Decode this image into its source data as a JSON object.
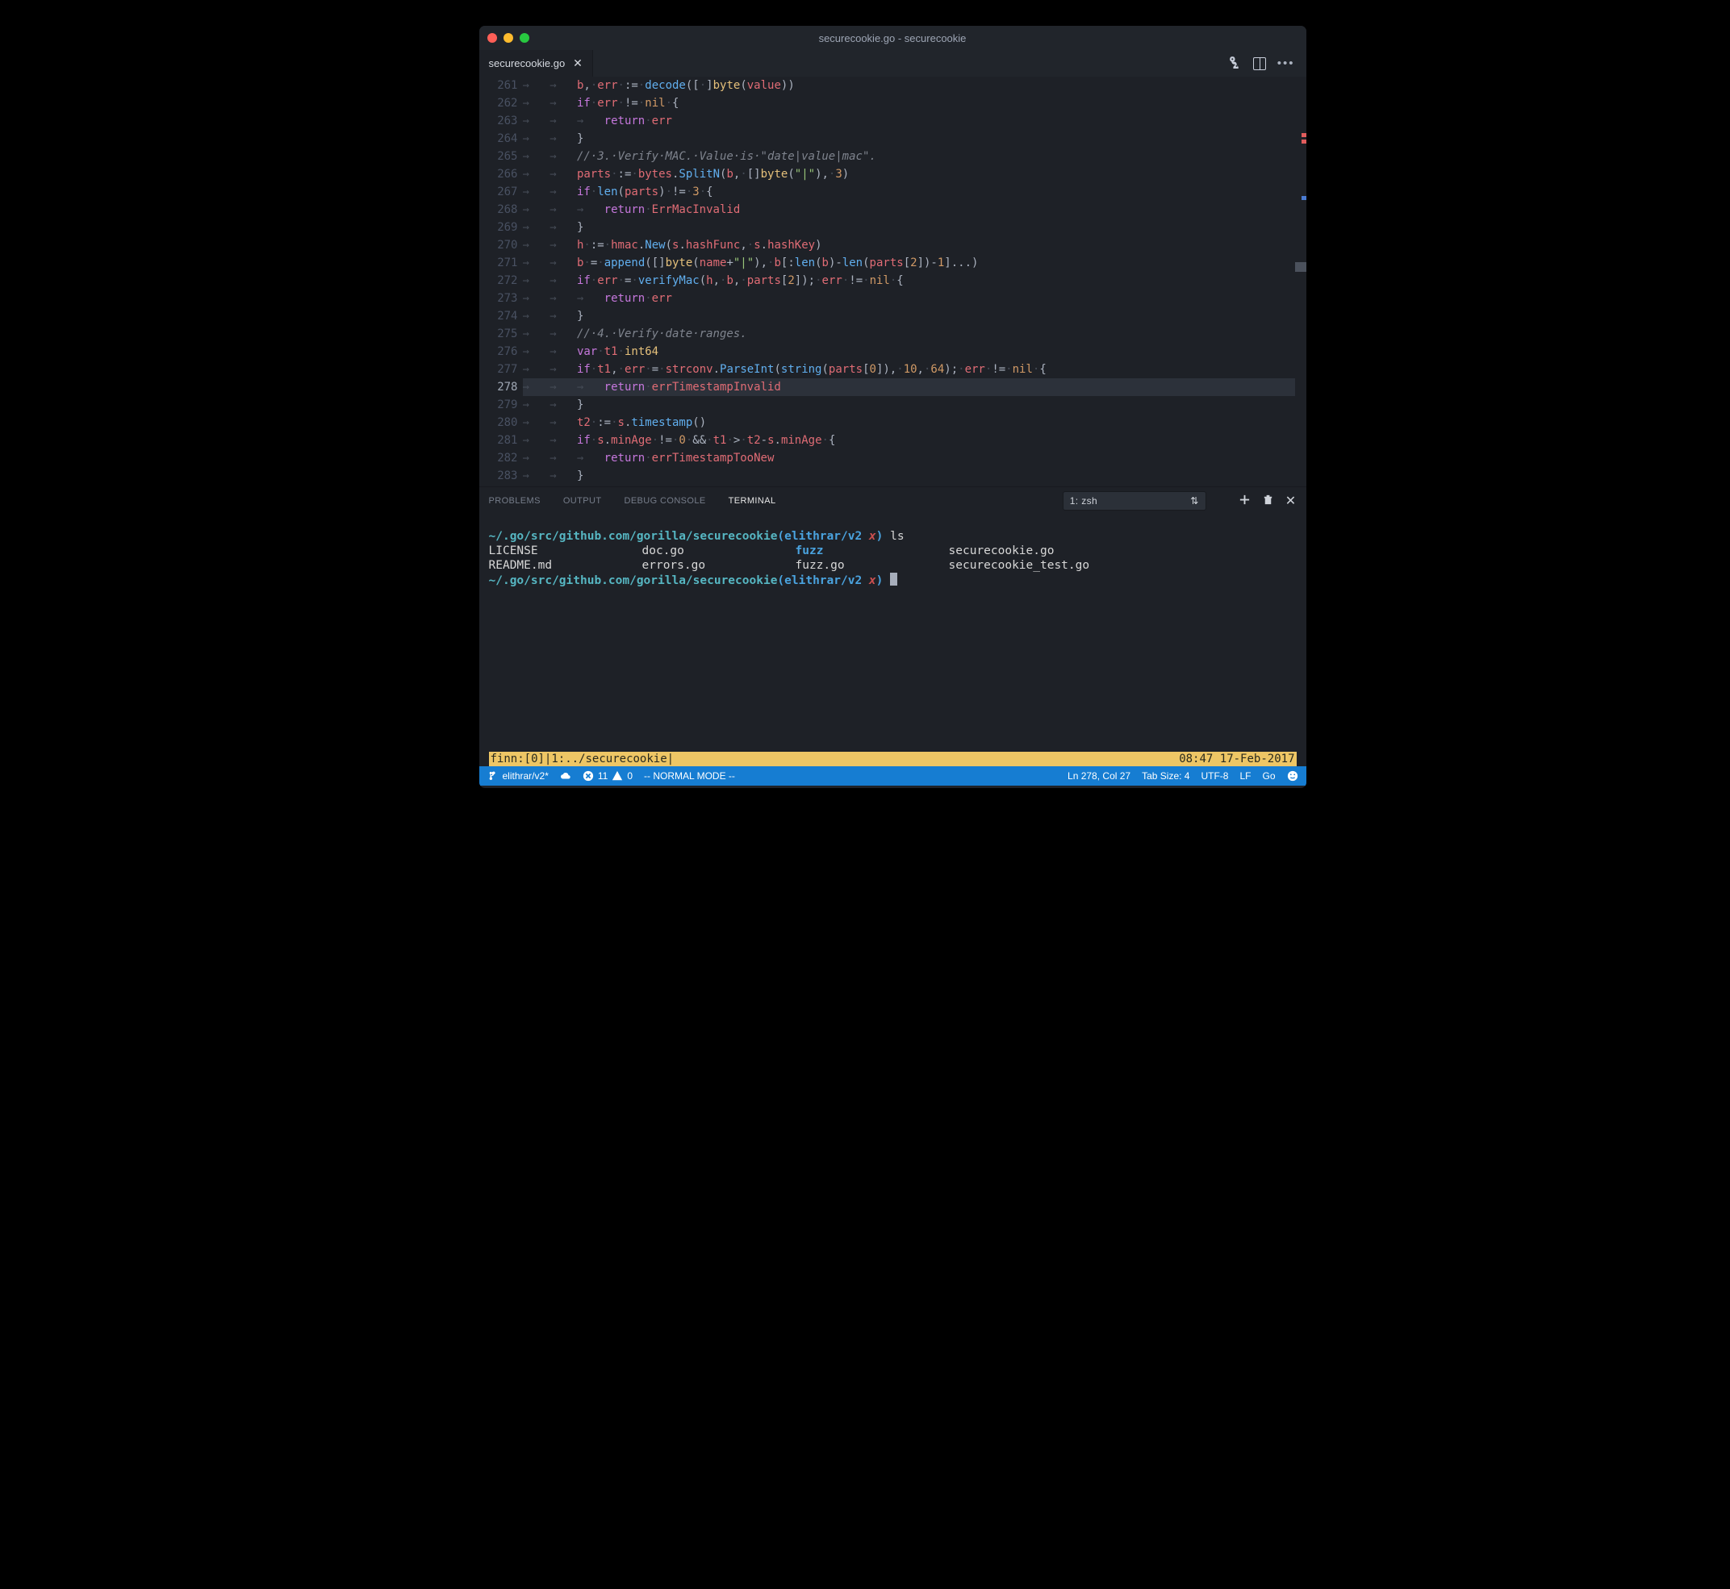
{
  "window": {
    "title": "securecookie.go - securecookie"
  },
  "tabs": [
    {
      "label": "securecookie.go",
      "closable": true,
      "active": true
    }
  ],
  "editor": {
    "highlighted_line": 278,
    "lines": [
      {
        "n": 261,
        "tokens": [
          [
            "ws",
            "→   "
          ],
          [
            "id",
            "b"
          ],
          [
            "p",
            ","
          ],
          [
            "ws",
            "·"
          ],
          [
            "id",
            "err"
          ],
          [
            "ws",
            "·"
          ],
          [
            "p",
            ":="
          ],
          [
            "ws",
            "·"
          ],
          [
            "fn",
            "decode"
          ],
          [
            "p",
            "(["
          ],
          [
            "ws",
            "·"
          ],
          [
            "p",
            "]"
          ],
          [
            "ty",
            "byte"
          ],
          [
            "p",
            "("
          ],
          [
            "id",
            "value"
          ],
          [
            "p",
            "))"
          ]
        ]
      },
      {
        "n": 262,
        "tokens": [
          [
            "ws",
            "→   "
          ],
          [
            "kw",
            "if"
          ],
          [
            "ws",
            "·"
          ],
          [
            "id",
            "err"
          ],
          [
            "ws",
            "·"
          ],
          [
            "p",
            "!="
          ],
          [
            "ws",
            "·"
          ],
          [
            "n",
            "nil"
          ],
          [
            "ws",
            "·"
          ],
          [
            "p",
            "{"
          ]
        ]
      },
      {
        "n": 263,
        "tokens": [
          [
            "ws",
            "→   →   "
          ],
          [
            "kw",
            "return"
          ],
          [
            "ws",
            "·"
          ],
          [
            "id",
            "err"
          ]
        ]
      },
      {
        "n": 264,
        "tokens": [
          [
            "ws",
            "→   "
          ],
          [
            "p",
            "}"
          ]
        ]
      },
      {
        "n": 265,
        "tokens": [
          [
            "ws",
            "→   "
          ],
          [
            "c",
            "//·3.·Verify·MAC.·Value·is·\"date|value|mac\"."
          ]
        ]
      },
      {
        "n": 266,
        "tokens": [
          [
            "ws",
            "→   "
          ],
          [
            "id",
            "parts"
          ],
          [
            "ws",
            "·"
          ],
          [
            "p",
            ":="
          ],
          [
            "ws",
            "·"
          ],
          [
            "id",
            "bytes"
          ],
          [
            "p",
            "."
          ],
          [
            "fn",
            "SplitN"
          ],
          [
            "p",
            "("
          ],
          [
            "id",
            "b"
          ],
          [
            "p",
            ","
          ],
          [
            "ws",
            "·"
          ],
          [
            "p",
            "[]"
          ],
          [
            "ty",
            "byte"
          ],
          [
            "p",
            "("
          ],
          [
            "s",
            "\"|\""
          ],
          [
            "p",
            "),"
          ],
          [
            "ws",
            "·"
          ],
          [
            "n",
            "3"
          ],
          [
            "p",
            ")"
          ]
        ]
      },
      {
        "n": 267,
        "tokens": [
          [
            "ws",
            "→   "
          ],
          [
            "kw",
            "if"
          ],
          [
            "ws",
            "·"
          ],
          [
            "fn",
            "len"
          ],
          [
            "p",
            "("
          ],
          [
            "id",
            "parts"
          ],
          [
            "p",
            ")"
          ],
          [
            "ws",
            "·"
          ],
          [
            "p",
            "!="
          ],
          [
            "ws",
            "·"
          ],
          [
            "n",
            "3"
          ],
          [
            "ws",
            "·"
          ],
          [
            "p",
            "{"
          ]
        ]
      },
      {
        "n": 268,
        "tokens": [
          [
            "ws",
            "→   →   "
          ],
          [
            "kw",
            "return"
          ],
          [
            "ws",
            "·"
          ],
          [
            "id",
            "ErrMacInvalid"
          ]
        ]
      },
      {
        "n": 269,
        "tokens": [
          [
            "ws",
            "→   "
          ],
          [
            "p",
            "}"
          ]
        ]
      },
      {
        "n": 270,
        "tokens": [
          [
            "ws",
            "→   "
          ],
          [
            "id",
            "h"
          ],
          [
            "ws",
            "·"
          ],
          [
            "p",
            ":="
          ],
          [
            "ws",
            "·"
          ],
          [
            "id",
            "hmac"
          ],
          [
            "p",
            "."
          ],
          [
            "fn",
            "New"
          ],
          [
            "p",
            "("
          ],
          [
            "id",
            "s"
          ],
          [
            "p",
            "."
          ],
          [
            "id",
            "hashFunc"
          ],
          [
            "p",
            ","
          ],
          [
            "ws",
            "·"
          ],
          [
            "id",
            "s"
          ],
          [
            "p",
            "."
          ],
          [
            "id",
            "hashKey"
          ],
          [
            "p",
            ")"
          ]
        ]
      },
      {
        "n": 271,
        "tokens": [
          [
            "ws",
            "→   "
          ],
          [
            "id",
            "b"
          ],
          [
            "ws",
            "·"
          ],
          [
            "p",
            "="
          ],
          [
            "ws",
            "·"
          ],
          [
            "fn",
            "append"
          ],
          [
            "p",
            "([]"
          ],
          [
            "ty",
            "byte"
          ],
          [
            "p",
            "("
          ],
          [
            "id",
            "name"
          ],
          [
            "p",
            "+"
          ],
          [
            "s",
            "\"|\""
          ],
          [
            "p",
            "),"
          ],
          [
            "ws",
            "·"
          ],
          [
            "id",
            "b"
          ],
          [
            "p",
            "[:"
          ],
          [
            "fn",
            "len"
          ],
          [
            "p",
            "("
          ],
          [
            "id",
            "b"
          ],
          [
            "p",
            ")-"
          ],
          [
            "fn",
            "len"
          ],
          [
            "p",
            "("
          ],
          [
            "id",
            "parts"
          ],
          [
            "p",
            "["
          ],
          [
            "n",
            "2"
          ],
          [
            "p",
            "])-"
          ],
          [
            "n",
            "1"
          ],
          [
            "p",
            "]...)"
          ]
        ]
      },
      {
        "n": 272,
        "tokens": [
          [
            "ws",
            "→   "
          ],
          [
            "kw",
            "if"
          ],
          [
            "ws",
            "·"
          ],
          [
            "id",
            "err"
          ],
          [
            "ws",
            "·"
          ],
          [
            "p",
            "="
          ],
          [
            "ws",
            "·"
          ],
          [
            "fn",
            "verifyMac"
          ],
          [
            "p",
            "("
          ],
          [
            "id",
            "h"
          ],
          [
            "p",
            ","
          ],
          [
            "ws",
            "·"
          ],
          [
            "id",
            "b"
          ],
          [
            "p",
            ","
          ],
          [
            "ws",
            "·"
          ],
          [
            "id",
            "parts"
          ],
          [
            "p",
            "["
          ],
          [
            "n",
            "2"
          ],
          [
            "p",
            "]);"
          ],
          [
            "ws",
            "·"
          ],
          [
            "id",
            "err"
          ],
          [
            "ws",
            "·"
          ],
          [
            "p",
            "!="
          ],
          [
            "ws",
            "·"
          ],
          [
            "n",
            "nil"
          ],
          [
            "ws",
            "·"
          ],
          [
            "p",
            "{"
          ]
        ]
      },
      {
        "n": 273,
        "tokens": [
          [
            "ws",
            "→   →   "
          ],
          [
            "kw",
            "return"
          ],
          [
            "ws",
            "·"
          ],
          [
            "id",
            "err"
          ]
        ]
      },
      {
        "n": 274,
        "tokens": [
          [
            "ws",
            "→   "
          ],
          [
            "p",
            "}"
          ]
        ]
      },
      {
        "n": 275,
        "tokens": [
          [
            "ws",
            "→   "
          ],
          [
            "c",
            "//·4.·Verify·date·ranges."
          ]
        ]
      },
      {
        "n": 276,
        "tokens": [
          [
            "ws",
            "→   "
          ],
          [
            "kw",
            "var"
          ],
          [
            "ws",
            "·"
          ],
          [
            "id",
            "t1"
          ],
          [
            "ws",
            "·"
          ],
          [
            "ty",
            "int64"
          ]
        ]
      },
      {
        "n": 277,
        "tokens": [
          [
            "ws",
            "→   "
          ],
          [
            "kw",
            "if"
          ],
          [
            "ws",
            "·"
          ],
          [
            "id",
            "t1"
          ],
          [
            "p",
            ","
          ],
          [
            "ws",
            "·"
          ],
          [
            "id",
            "err"
          ],
          [
            "ws",
            "·"
          ],
          [
            "p",
            "="
          ],
          [
            "ws",
            "·"
          ],
          [
            "id",
            "strconv"
          ],
          [
            "p",
            "."
          ],
          [
            "fn",
            "ParseInt"
          ],
          [
            "p",
            "("
          ],
          [
            "fn",
            "string"
          ],
          [
            "p",
            "("
          ],
          [
            "id",
            "parts"
          ],
          [
            "p",
            "["
          ],
          [
            "n",
            "0"
          ],
          [
            "p",
            "]),"
          ],
          [
            "ws",
            "·"
          ],
          [
            "n",
            "10"
          ],
          [
            "p",
            ","
          ],
          [
            "ws",
            "·"
          ],
          [
            "n",
            "64"
          ],
          [
            "p",
            ");"
          ],
          [
            "ws",
            "·"
          ],
          [
            "id",
            "err"
          ],
          [
            "ws",
            "·"
          ],
          [
            "p",
            "!="
          ],
          [
            "ws",
            "·"
          ],
          [
            "n",
            "nil"
          ],
          [
            "ws",
            "·"
          ],
          [
            "p",
            "{"
          ]
        ]
      },
      {
        "n": 278,
        "tokens": [
          [
            "ws",
            "→   →   "
          ],
          [
            "kw",
            "return"
          ],
          [
            "ws",
            "·"
          ],
          [
            "id",
            "errTimestampInvalid"
          ]
        ]
      },
      {
        "n": 279,
        "tokens": [
          [
            "ws",
            "→   "
          ],
          [
            "p",
            "}"
          ]
        ]
      },
      {
        "n": 280,
        "tokens": [
          [
            "ws",
            "→   "
          ],
          [
            "id",
            "t2"
          ],
          [
            "ws",
            "·"
          ],
          [
            "p",
            ":="
          ],
          [
            "ws",
            "·"
          ],
          [
            "id",
            "s"
          ],
          [
            "p",
            "."
          ],
          [
            "fn",
            "timestamp"
          ],
          [
            "p",
            "()"
          ]
        ]
      },
      {
        "n": 281,
        "tokens": [
          [
            "ws",
            "→   "
          ],
          [
            "kw",
            "if"
          ],
          [
            "ws",
            "·"
          ],
          [
            "id",
            "s"
          ],
          [
            "p",
            "."
          ],
          [
            "id",
            "minAge"
          ],
          [
            "ws",
            "·"
          ],
          [
            "p",
            "!="
          ],
          [
            "ws",
            "·"
          ],
          [
            "n",
            "0"
          ],
          [
            "ws",
            "·"
          ],
          [
            "p",
            "&&"
          ],
          [
            "ws",
            "·"
          ],
          [
            "id",
            "t1"
          ],
          [
            "ws",
            "·"
          ],
          [
            "p",
            ">"
          ],
          [
            "ws",
            "·"
          ],
          [
            "id",
            "t2"
          ],
          [
            "p",
            "-"
          ],
          [
            "id",
            "s"
          ],
          [
            "p",
            "."
          ],
          [
            "id",
            "minAge"
          ],
          [
            "ws",
            "·"
          ],
          [
            "p",
            "{"
          ]
        ]
      },
      {
        "n": 282,
        "tokens": [
          [
            "ws",
            "→   →   "
          ],
          [
            "kw",
            "return"
          ],
          [
            "ws",
            "·"
          ],
          [
            "id",
            "errTimestampTooNew"
          ]
        ]
      },
      {
        "n": 283,
        "tokens": [
          [
            "ws",
            "→   "
          ],
          [
            "p",
            "}"
          ]
        ]
      }
    ]
  },
  "panel": {
    "tabs": {
      "problems": "PROBLEMS",
      "output": "OUTPUT",
      "debug": "DEBUG CONSOLE",
      "terminal": "TERMINAL"
    },
    "active_tab": "terminal",
    "terminal_picker": "1: zsh"
  },
  "terminal": {
    "prompt_path": "~/.go/src/github.com/gorilla/securecookie",
    "branch": "elithrar/v2 ",
    "branch_dirty": "x",
    "cmd": "ls",
    "ls": {
      "c1": [
        "LICENSE",
        "README.md"
      ],
      "c2": [
        "doc.go",
        "errors.go"
      ],
      "c3": [
        "fuzz",
        "fuzz.go"
      ],
      "c4": [
        "securecookie.go",
        "securecookie_test.go"
      ]
    },
    "tmux_left": "finn:[0]|1:../securecookie|",
    "tmux_right": "08:47 17-Feb-2017"
  },
  "status": {
    "branch": "elithrar/v2*",
    "errors": "11",
    "warnings": "0",
    "mode": "--  NORMAL MODE  --",
    "pos": "Ln 278, Col 27",
    "tab": "Tab Size: 4",
    "enc": "UTF-8",
    "eol": "LF",
    "lang": "Go"
  }
}
